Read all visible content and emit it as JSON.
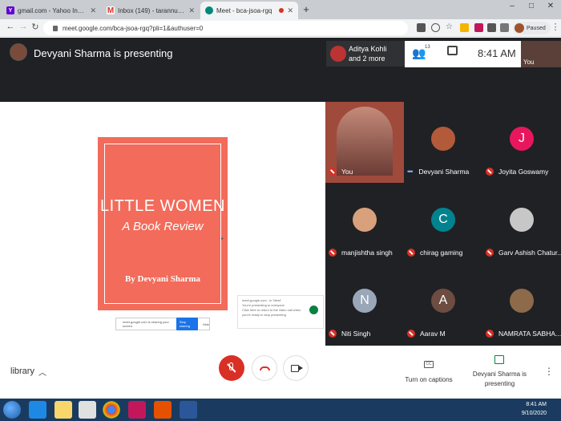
{
  "browser": {
    "tabs": [
      {
        "label": "gmail.com - Yahoo India Search R",
        "favicon": "yahoo-icon",
        "color": "#6001d2",
        "glyph": "Y"
      },
      {
        "label": "Inbox (149) - tarannum@theindi",
        "favicon": "gmail-icon",
        "color": "#ffffff",
        "glyph": "M"
      },
      {
        "label": "Meet - bca-jsoa-rgq",
        "favicon": "meet-icon",
        "color": "#00897b",
        "glyph": ""
      }
    ],
    "new_tab": "+",
    "window_controls": [
      "–",
      "□",
      "✕"
    ],
    "url": "meet.google.com/bca-jsoa-rgq?pli=1&authuser=0",
    "profile_status": "Paused"
  },
  "meet": {
    "presenter_banner": "Devyani Sharma is presenting",
    "participants_chip": {
      "line1": "Aditya Kohli",
      "line2": "and 2 more"
    },
    "people_count": "13",
    "time": "8:41 AM",
    "self_label": "You",
    "slide": {
      "title": "LITTLE WOMEN",
      "subtitle": "A Book Review",
      "byline": "By Devyani Sharma",
      "bg_color": "#f26b5b"
    },
    "share_bar": {
      "text": "meet.google.com is sharing your screen.",
      "stop": "Stop sharing",
      "hide": "Hide"
    },
    "present_card": {
      "domain": "meet.google.com · in 'Meet'",
      "line1": "You're presenting to everyone",
      "line2": "Click here to return to the video call when you're ready to stop presenting"
    },
    "tiles": [
      {
        "name": "You",
        "avatar": "",
        "avatar_color": "#6b3b34",
        "status": "muted"
      },
      {
        "name": "Devyani Sharma",
        "avatar": "",
        "avatar_color": "#b35a3a",
        "status": "speaking"
      },
      {
        "name": "Joyita Goswamy",
        "avatar": "J",
        "avatar_color": "#e8175d",
        "status": "muted"
      },
      {
        "name": "manjishtha singh",
        "avatar": "",
        "avatar_color": "#d9a07c",
        "status": "muted"
      },
      {
        "name": "chirag gaming",
        "avatar": "C",
        "avatar_color": "#00838f",
        "status": "muted"
      },
      {
        "name": "Garv Ashish Chatur...",
        "avatar": "",
        "avatar_color": "#c7c7c7",
        "status": "muted"
      },
      {
        "name": "Niti Singh",
        "avatar": "N",
        "avatar_color": "#9aa7b8",
        "status": "muted"
      },
      {
        "name": "Aarav M",
        "avatar": "A",
        "avatar_color": "#6d4c41",
        "status": "muted"
      },
      {
        "name": "NAMRATA SABHA...",
        "avatar": "",
        "avatar_color": "#8c6a4a",
        "status": "muted"
      }
    ],
    "bottom": {
      "meeting_details": "library",
      "captions": "Turn on captions",
      "presenting": "Devyani Sharma is presenting"
    }
  },
  "taskbar": {
    "time": "8:41 AM",
    "date": "9/10/2020"
  }
}
